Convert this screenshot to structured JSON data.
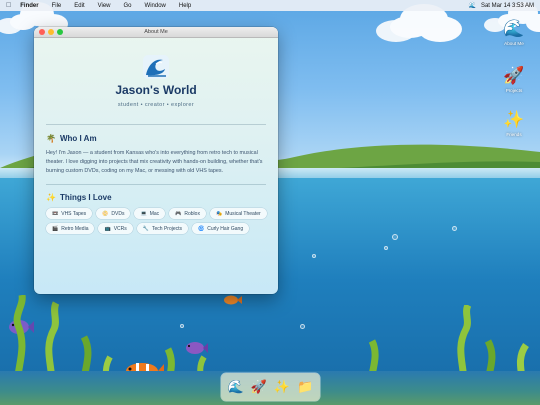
{
  "menubar": {
    "apple_icon": "apple-icon",
    "items": [
      "Finder",
      "File",
      "Edit",
      "View",
      "Go",
      "Window",
      "Help"
    ],
    "status_icon": "wave-icon",
    "clock": "Sat Mar 14 3:53 AM"
  },
  "window": {
    "title": "About Me",
    "site_title": "Jason's World",
    "tagline": "student • creator • explorer",
    "about": {
      "heading": "Who I Am",
      "heading_emoji": "🌴",
      "body": "Hey! I'm Jason — a student from Kansas who's into everything from retro tech to musical theater. I love digging into projects that mix creativity with hands-on building, whether that's burning custom DVDs, coding on my Mac, or messing with old VHS tapes."
    },
    "interests": {
      "heading": "Things I Love",
      "heading_emoji": "✨",
      "tags": [
        {
          "emoji": "📼",
          "label": "VHS Tapes"
        },
        {
          "emoji": "📀",
          "label": "DVDs"
        },
        {
          "emoji": "💻",
          "label": "Mac"
        },
        {
          "emoji": "🎮",
          "label": "Roblox"
        },
        {
          "emoji": "🎭",
          "label": "Musical Theater"
        },
        {
          "emoji": "🎬",
          "label": "Retro Media"
        },
        {
          "emoji": "📺",
          "label": "VCRs"
        },
        {
          "emoji": "🔧",
          "label": "Tech Projects"
        },
        {
          "emoji": "🌀",
          "label": "Curly Hair Gang"
        }
      ]
    }
  },
  "desktop_icons": [
    {
      "icon": "wave-icon",
      "emoji": "🌊",
      "label": "About Me"
    },
    {
      "icon": "rocket-icon",
      "emoji": "🚀",
      "label": "Projects"
    },
    {
      "icon": "sparkles-icon",
      "emoji": "✨",
      "label": "Friends"
    }
  ],
  "dock": [
    {
      "icon": "wave-icon",
      "emoji": "🌊"
    },
    {
      "icon": "rocket-icon",
      "emoji": "🚀"
    },
    {
      "icon": "sparkles-icon",
      "emoji": "✨"
    },
    {
      "icon": "folder-icon",
      "emoji": "📁"
    }
  ],
  "colors": {
    "accent": "#1b3a66",
    "close": "#ff5f57",
    "minimize": "#febc2e",
    "zoom": "#28c840"
  }
}
